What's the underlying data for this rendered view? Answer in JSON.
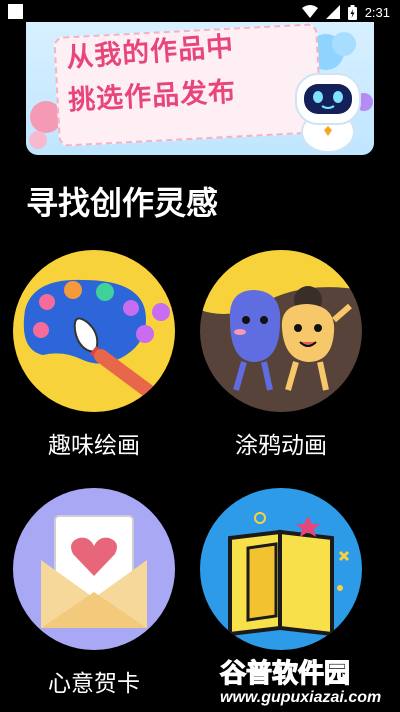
{
  "status": {
    "time": "2:31"
  },
  "banner": {
    "line1": "从我的作品中",
    "line2": "挑选作品发布"
  },
  "section": {
    "title": "寻找创作灵感"
  },
  "tiles": [
    {
      "label": "趣味绘画"
    },
    {
      "label": "涂鸦动画"
    },
    {
      "label": "心意贺卡"
    },
    {
      "label": ""
    }
  ],
  "watermark": {
    "title": "谷普软件园",
    "url": "www.gupuxiazai.com"
  },
  "colors": {
    "accent_pink": "#e8467a",
    "tile_yellow": "#f7d23a",
    "tile_lavender": "#a9a8f4",
    "tile_blue": "#2d9be8"
  }
}
